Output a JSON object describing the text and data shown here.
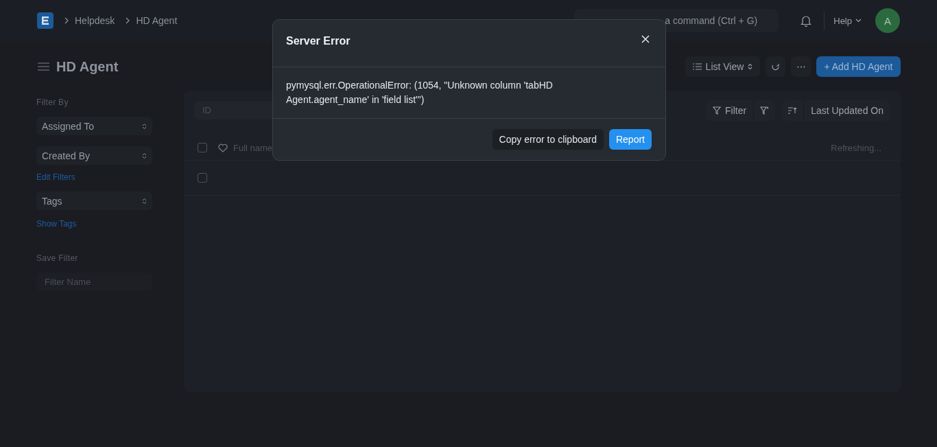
{
  "breadcrumbs": [
    "Helpdesk",
    "HD Agent"
  ],
  "search": {
    "placeholder": "a command (Ctrl + G)"
  },
  "help": "Help",
  "avatar": "A",
  "page_title": "HD Agent",
  "view_switcher": "List View",
  "add_button": "+ Add HD Agent",
  "sidebar": {
    "filter_heading": "Filter By",
    "filters": [
      "Assigned To",
      "Created By"
    ],
    "edit_filters": "Edit Filters",
    "tags": "Tags",
    "show_tags": "Show Tags",
    "save_heading": "Save Filter",
    "filter_name_placeholder": "Filter Name"
  },
  "list": {
    "id_placeholder": "ID",
    "filter_button": "Filter",
    "sort_label": "Last Updated On",
    "select_all_checked": false,
    "columns": [
      "Full name"
    ],
    "status": "Refreshing...",
    "rows": [
      {
        "checked": false
      }
    ]
  },
  "dialog": {
    "title": "Server Error",
    "message": "pymysql.err.OperationalError: (1054, \"Unknown column 'tabHD Agent.agent_name' in 'field list'\")",
    "buttons": [
      {
        "label": "Copy error to clipboard",
        "kind": "secondary"
      },
      {
        "label": "Report",
        "kind": "primary"
      }
    ]
  }
}
